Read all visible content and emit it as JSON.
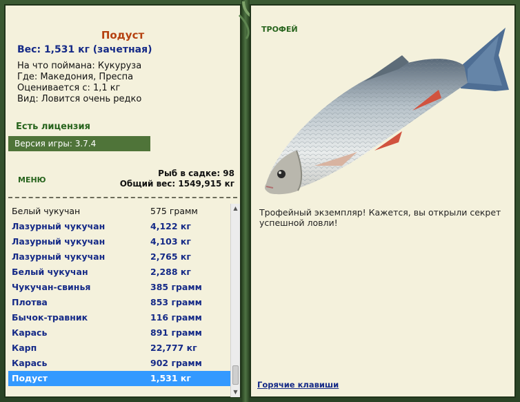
{
  "fish": {
    "name": "Подуст",
    "weight": "Вес: 1,531 кг (зачетная)",
    "bait": "На что поймана: Кукуруза",
    "location": "Где: Македония, Преспа",
    "rated_from": "Оценивается с: 1,1 кг",
    "rarity": "Вид: Ловится очень редко"
  },
  "license": "Есть лицензия",
  "version": "Версия игры: 3.7.4",
  "menu_label": "МЕНЮ",
  "stats": {
    "count": "Рыб в садке: 98",
    "total": "Общий вес: 1549,915 кг"
  },
  "catch_list": [
    {
      "name": "Белый чукучан",
      "weight": "575 грамм",
      "style": "plain"
    },
    {
      "name": "Лазурный чукучан",
      "weight": "4,122 кг",
      "style": "bold"
    },
    {
      "name": "Лазурный чукучан",
      "weight": "4,103 кг",
      "style": "bold"
    },
    {
      "name": "Лазурный чукучан",
      "weight": "2,765 кг",
      "style": "bold"
    },
    {
      "name": "Белый чукучан",
      "weight": "2,288 кг",
      "style": "bold"
    },
    {
      "name": "Чукучан-свинья",
      "weight": "385 грамм",
      "style": "bold"
    },
    {
      "name": "Плотва",
      "weight": "853 грамм",
      "style": "bold"
    },
    {
      "name": "Бычок-травник",
      "weight": "116 грамм",
      "style": "bold"
    },
    {
      "name": "Карась",
      "weight": "891 грамм",
      "style": "bold"
    },
    {
      "name": "Карп",
      "weight": "22,777 кг",
      "style": "bold"
    },
    {
      "name": "Карась",
      "weight": "902 грамм",
      "style": "bold"
    },
    {
      "name": "Подуст",
      "weight": "1,531 кг",
      "style": "sel"
    }
  ],
  "trophy": {
    "title": "ТРОФЕЙ",
    "message": "Трофейный экземпляр! Кажется, вы открыли секрет успешной ловли!",
    "fish_icon": "fish-image"
  },
  "hotkeys": "Горячие клавиши",
  "colors": {
    "frame": "#2f4a2a",
    "panel": "#f4f1dc",
    "accent_green": "#27641d",
    "title_orange": "#b5400f",
    "text_blue": "#152a87",
    "selection": "#3399ff"
  }
}
